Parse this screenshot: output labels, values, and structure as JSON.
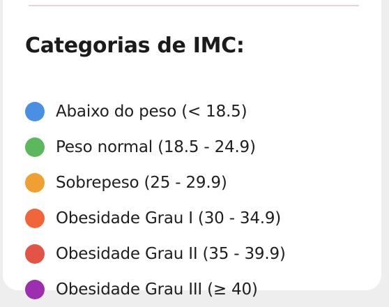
{
  "title": "Categorias de IMC:",
  "categories": [
    {
      "label": "Abaixo do peso (< 18.5)",
      "color": "#4a90e2"
    },
    {
      "label": "Peso normal (18.5 - 24.9)",
      "color": "#5cb85c"
    },
    {
      "label": "Sobrepeso (25 - 29.9)",
      "color": "#f0a030"
    },
    {
      "label": "Obesidade Grau I (30 - 34.9)",
      "color": "#f0663a"
    },
    {
      "label": "Obesidade Grau II (35 - 39.9)",
      "color": "#e45446"
    },
    {
      "label": "Obesidade Grau III (≥ 40)",
      "color": "#9b2fae"
    }
  ]
}
